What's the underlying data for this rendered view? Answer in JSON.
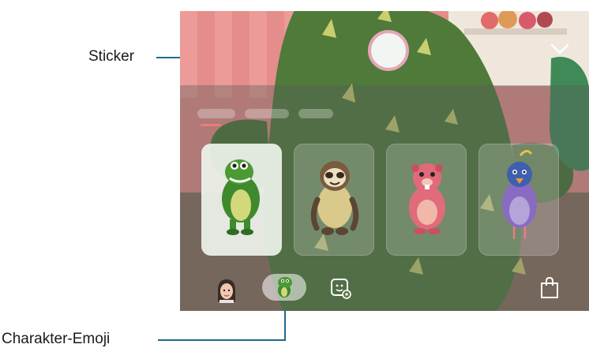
{
  "callouts": {
    "sticker": "Sticker",
    "charakter_emoji": "Charakter-Emoji"
  },
  "colors": {
    "callout_line": "#1d6a8e",
    "active_tab_indicator": "#ee7b7b",
    "shutter_ring": "#e6a6b6"
  },
  "stickers": [
    {
      "character": "dinosaur",
      "selected": true
    },
    {
      "character": "sloth",
      "selected": false
    },
    {
      "character": "beaver",
      "selected": false
    },
    {
      "character": "bird",
      "selected": false
    }
  ],
  "bottom_bar": [
    {
      "icon": "ar-emoji-avatar-icon",
      "active": false
    },
    {
      "icon": "character-emoji-icon",
      "active": true
    },
    {
      "icon": "sticker-settings-icon",
      "active": false
    },
    {
      "icon": "store-bag-icon",
      "active": false
    }
  ]
}
